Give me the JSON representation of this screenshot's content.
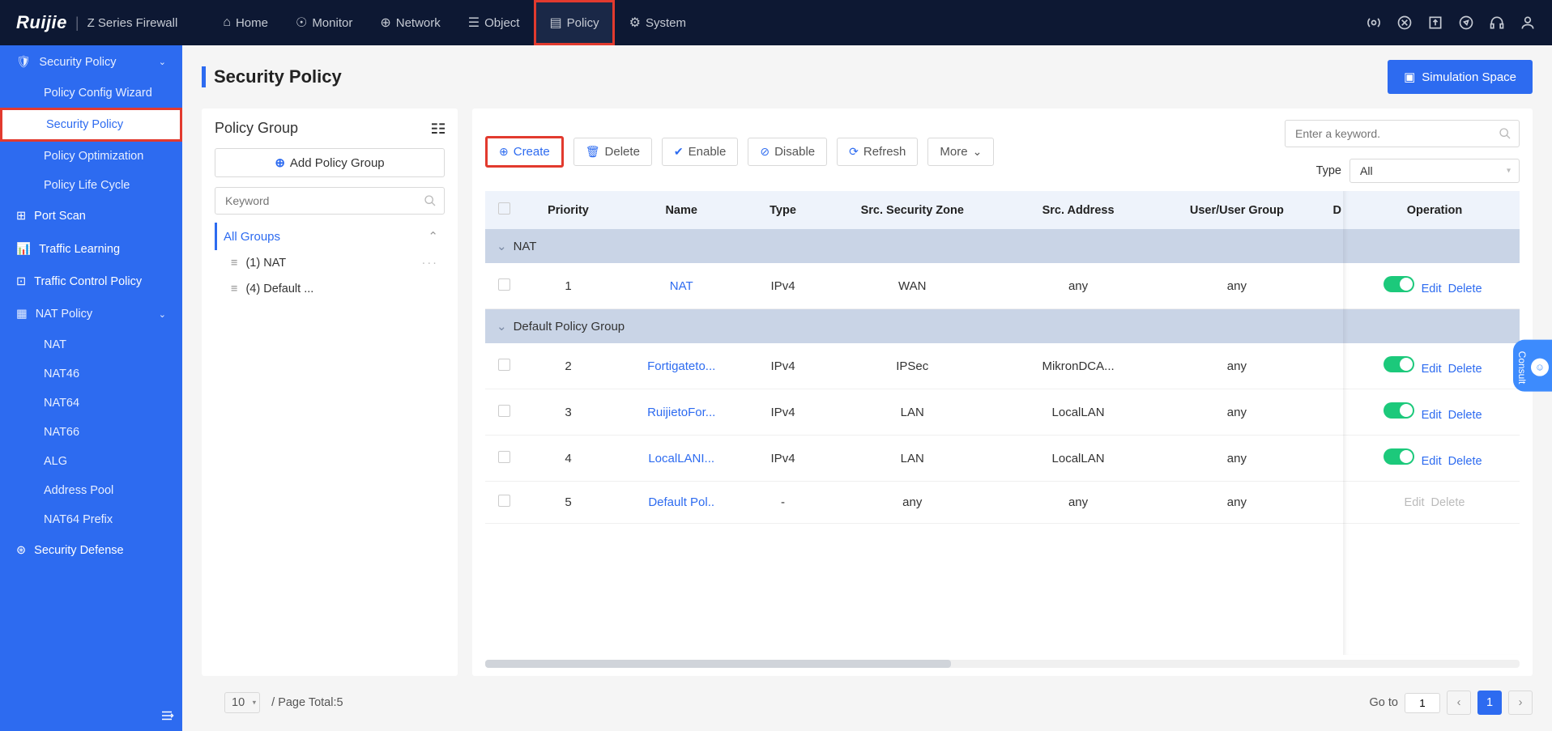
{
  "brand": {
    "name": "Ruijie",
    "product": "Z Series Firewall"
  },
  "topnav": {
    "items": [
      {
        "label": "Home"
      },
      {
        "label": "Monitor"
      },
      {
        "label": "Network"
      },
      {
        "label": "Object"
      },
      {
        "label": "Policy"
      },
      {
        "label": "System"
      }
    ]
  },
  "sidebar": {
    "security_policy": {
      "label": "Security Policy",
      "children": [
        {
          "label": "Policy Config Wizard"
        },
        {
          "label": "Security Policy"
        },
        {
          "label": "Policy Optimization"
        },
        {
          "label": "Policy Life Cycle"
        }
      ]
    },
    "port_scan": "Port Scan",
    "traffic_learning": "Traffic Learning",
    "traffic_control": "Traffic Control Policy",
    "nat_policy": {
      "label": "NAT Policy",
      "children": [
        {
          "label": "NAT"
        },
        {
          "label": "NAT46"
        },
        {
          "label": "NAT64"
        },
        {
          "label": "NAT66"
        },
        {
          "label": "ALG"
        },
        {
          "label": "Address Pool"
        },
        {
          "label": "NAT64 Prefix"
        }
      ]
    },
    "security_defense": "Security Defense"
  },
  "page": {
    "title": "Security Policy",
    "simulation": "Simulation Space"
  },
  "policy_group": {
    "title": "Policy Group",
    "add": "Add Policy Group",
    "keyword_placeholder": "Keyword",
    "all_groups": "All Groups",
    "groups": [
      {
        "label": "(1) NAT"
      },
      {
        "label": "(4) Default ..."
      }
    ]
  },
  "toolbar": {
    "create": "Create",
    "delete": "Delete",
    "enable": "Enable",
    "disable": "Disable",
    "refresh": "Refresh",
    "more": "More",
    "search_placeholder": "Enter a keyword.",
    "type_label": "Type",
    "type_value": "All"
  },
  "table": {
    "headers": {
      "priority": "Priority",
      "name": "Name",
      "type": "Type",
      "src_zone": "Src. Security Zone",
      "src_addr": "Src. Address",
      "user_group": "User/User Group",
      "d": "D",
      "operation": "Operation"
    },
    "group1": "NAT",
    "group2": "Default Policy Group",
    "rows": [
      {
        "priority": "1",
        "name": "NAT",
        "type": "IPv4",
        "zone": "WAN",
        "addr": "any",
        "ug": "any",
        "enabled": true
      },
      {
        "priority": "2",
        "name": "Fortigateto...",
        "type": "IPv4",
        "zone": "IPSec",
        "addr": "MikronDCA...",
        "ug": "any",
        "enabled": true
      },
      {
        "priority": "3",
        "name": "RuijietoFor...",
        "type": "IPv4",
        "zone": "LAN",
        "addr": "LocalLAN",
        "ug": "any",
        "enabled": true
      },
      {
        "priority": "4",
        "name": "LocalLANI...",
        "type": "IPv4",
        "zone": "LAN",
        "addr": "LocalLAN",
        "ug": "any",
        "enabled": true
      },
      {
        "priority": "5",
        "name": "Default Pol..",
        "type": "-",
        "zone": "any",
        "addr": "any",
        "ug": "any",
        "enabled": false
      }
    ],
    "op": {
      "edit": "Edit",
      "delete": "Delete"
    }
  },
  "pager": {
    "size": "10",
    "total_label": "/ Page Total:5",
    "goto_label": "Go to",
    "goto_value": "1",
    "current": "1"
  }
}
